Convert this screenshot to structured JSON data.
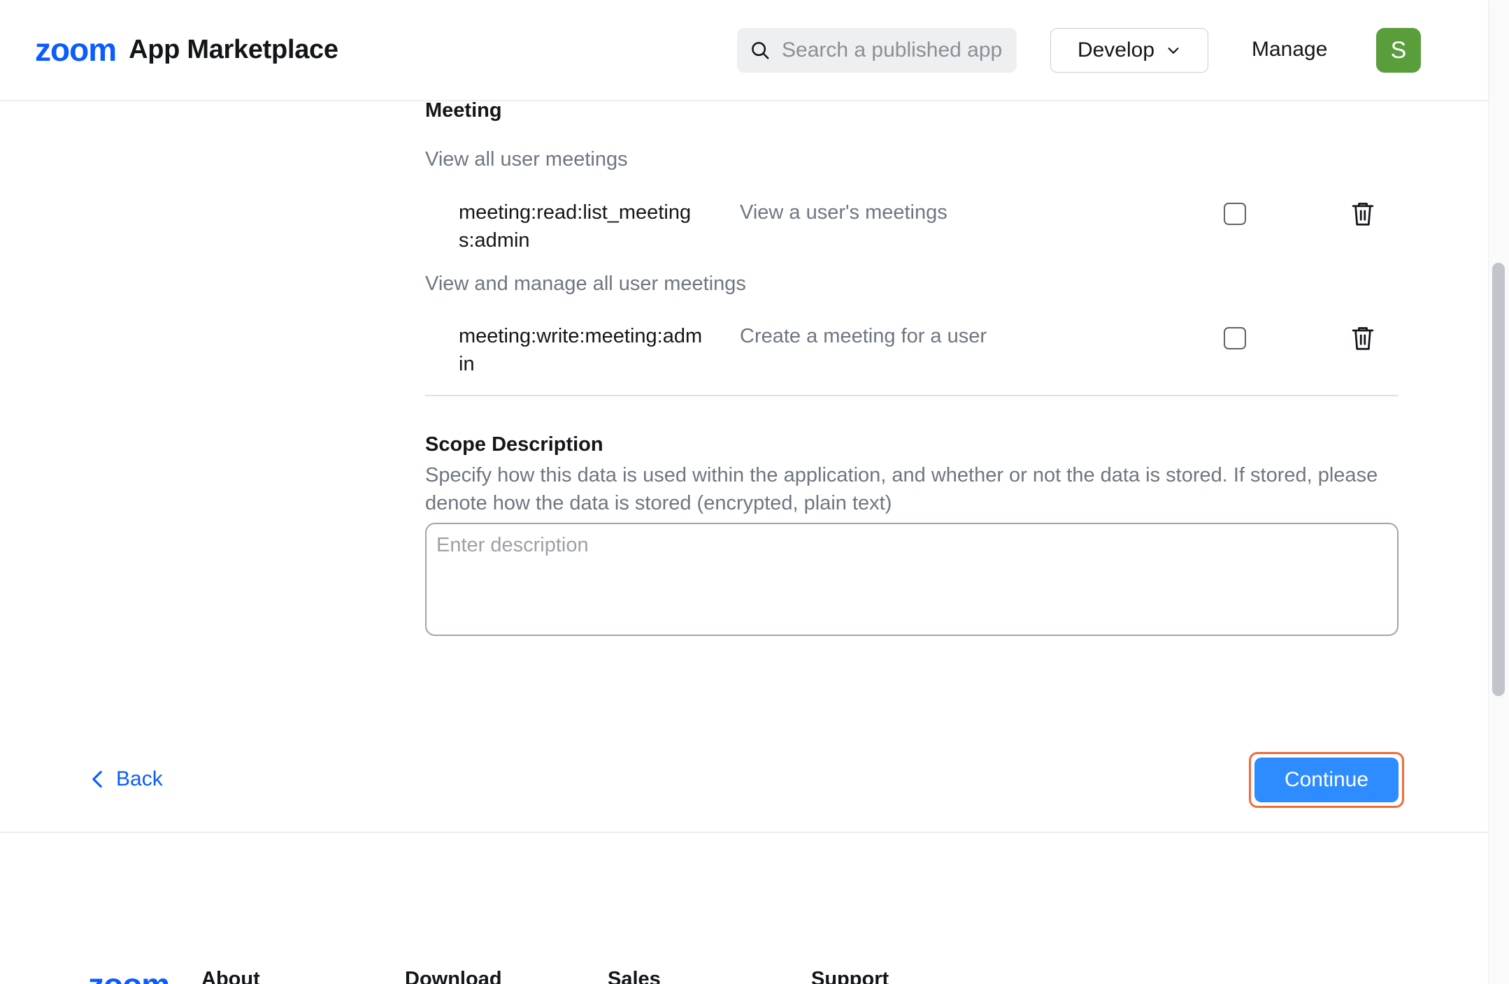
{
  "header": {
    "logo_text": "zoom",
    "app_title": "App Marketplace",
    "search_placeholder": "Search a published app",
    "develop_label": "Develop",
    "manage_label": "Manage",
    "avatar_initial": "S",
    "avatar_color": "#5a9e3c"
  },
  "scopes": {
    "section_title": "Meeting",
    "groups": [
      {
        "label": "View all user meetings",
        "scope": "meeting:read:list_meetings:admin",
        "description": "View a user's meetings",
        "checked": false
      },
      {
        "label": "View and manage all user meetings",
        "scope": "meeting:write:meeting:admin",
        "description": "Create a meeting for a user",
        "checked": false
      }
    ]
  },
  "scope_description": {
    "title": "Scope Description",
    "help_text": "Specify how this data is used within the application, and whether or not the data is stored. If stored, please denote how the data is stored (encrypted, plain text)",
    "placeholder": "Enter description"
  },
  "nav": {
    "back_label": "Back",
    "continue_label": "Continue"
  },
  "footer": {
    "logo_text": "zoom",
    "columns": [
      "About",
      "Download",
      "Sales",
      "Support"
    ]
  },
  "colors": {
    "brand": "#0b5cff",
    "primary_button": "#2d8cff",
    "focus_ring": "#f26b3a"
  }
}
